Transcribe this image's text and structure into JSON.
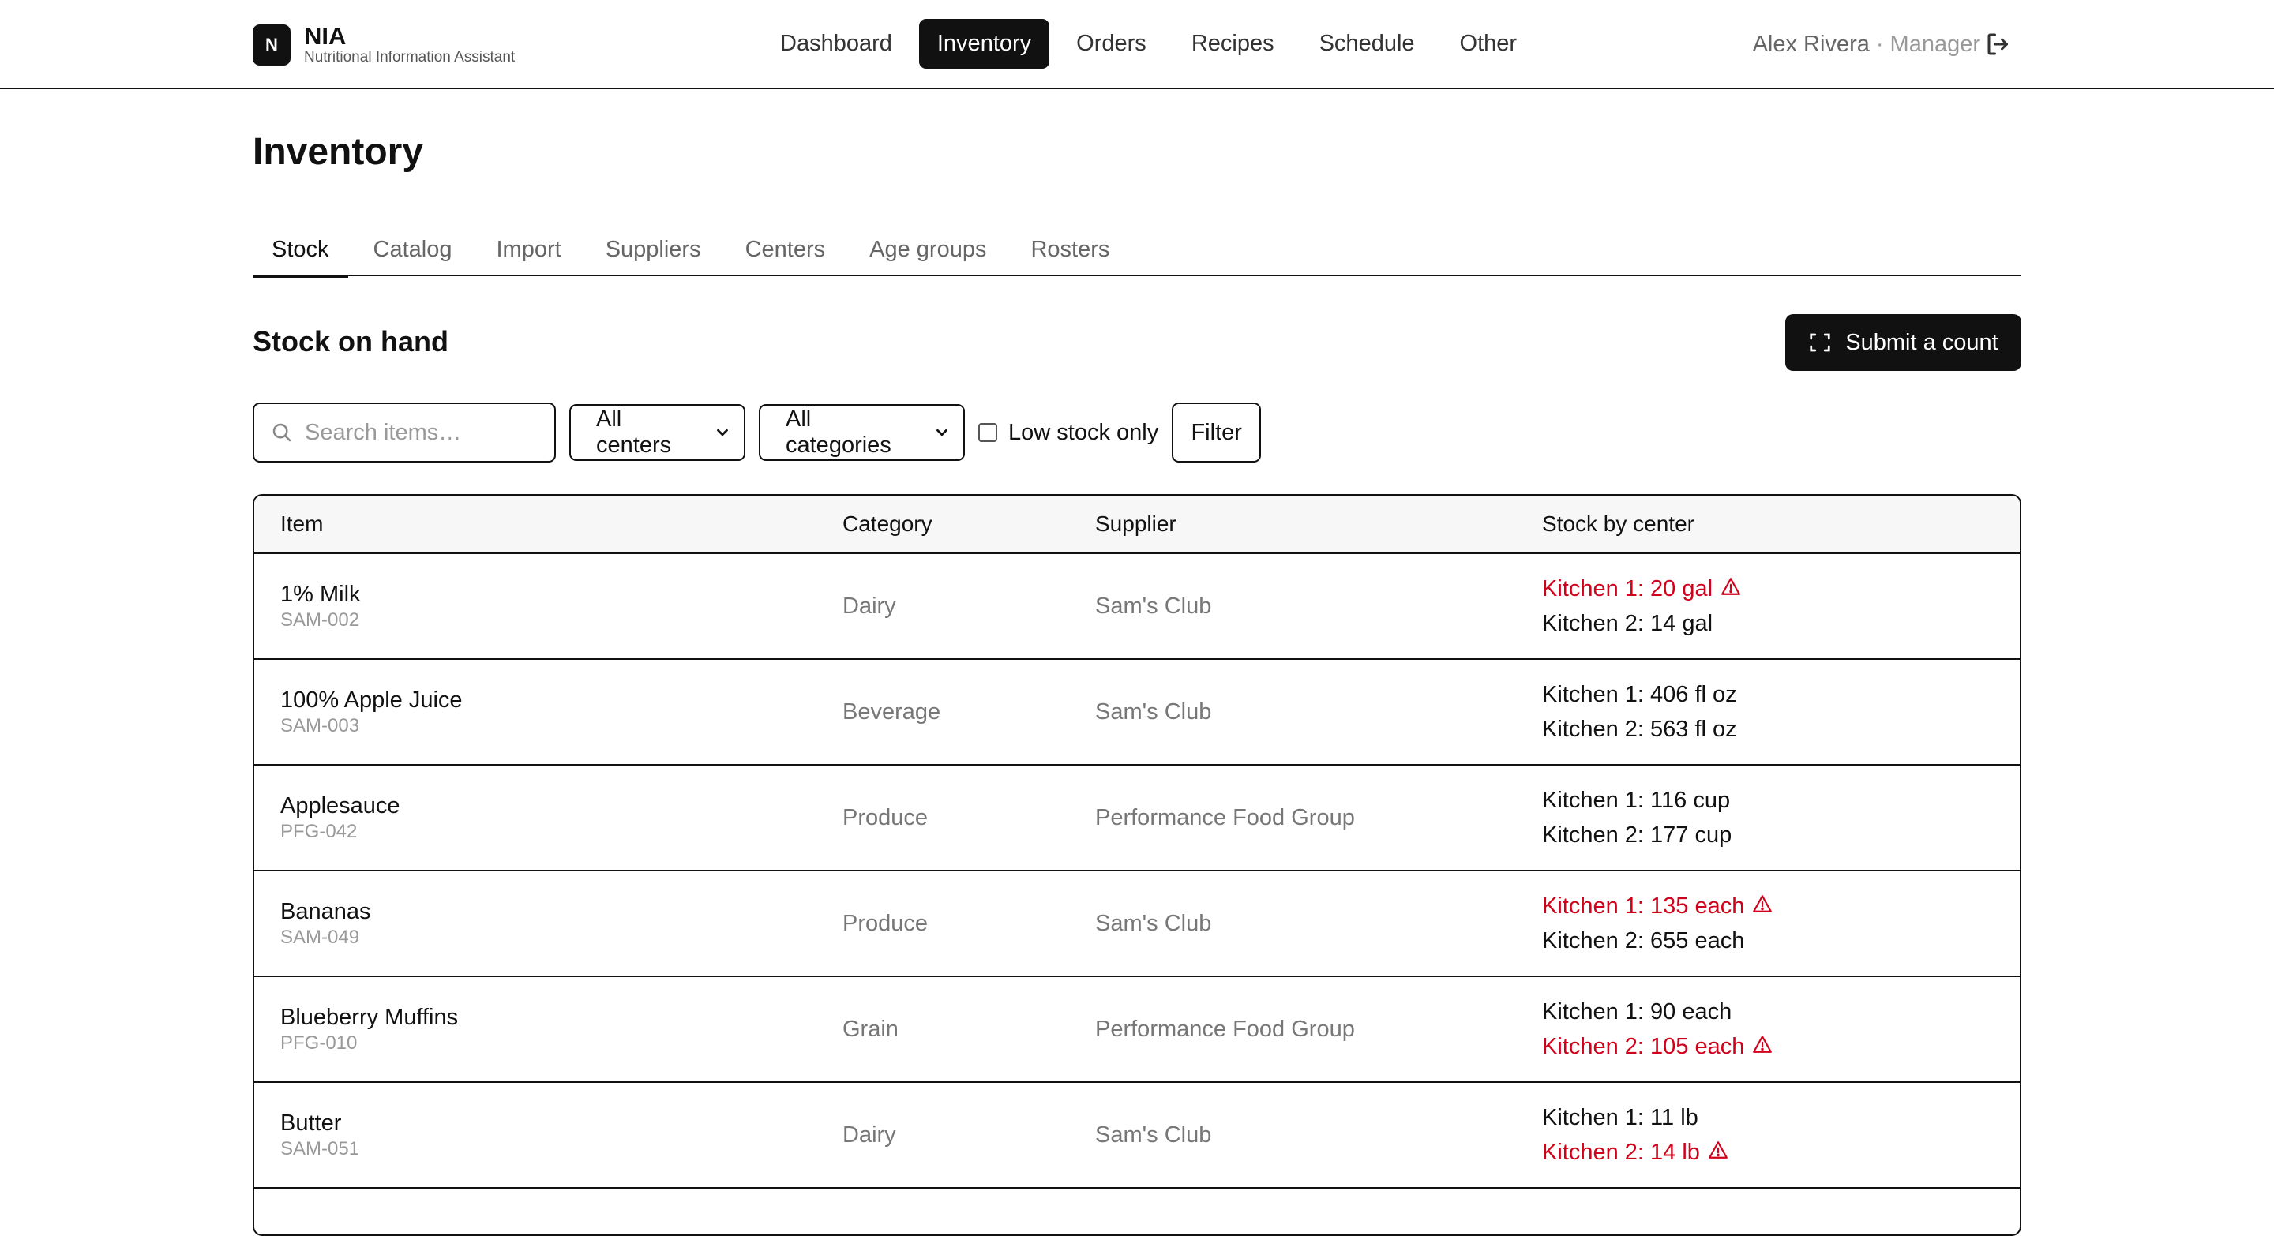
{
  "app": {
    "logo_letter": "N",
    "name": "NIA",
    "subtitle": "Nutritional Information Assistant"
  },
  "nav": {
    "items": [
      {
        "label": "Dashboard",
        "active": false
      },
      {
        "label": "Inventory",
        "active": true
      },
      {
        "label": "Orders",
        "active": false
      },
      {
        "label": "Recipes",
        "active": false
      },
      {
        "label": "Schedule",
        "active": false
      },
      {
        "label": "Other",
        "active": false
      }
    ]
  },
  "user": {
    "name": "Alex Rivera",
    "separator": "·",
    "role": "Manager",
    "logout_icon": "logout-icon"
  },
  "page": {
    "title": "Inventory",
    "tabs": [
      {
        "label": "Stock",
        "active": true
      },
      {
        "label": "Catalog",
        "active": false
      },
      {
        "label": "Import",
        "active": false
      },
      {
        "label": "Suppliers",
        "active": false
      },
      {
        "label": "Centers",
        "active": false
      },
      {
        "label": "Age groups",
        "active": false
      },
      {
        "label": "Rosters",
        "active": false
      }
    ],
    "section_title": "Stock on hand",
    "submit_label": "Submit a count"
  },
  "filters": {
    "search_placeholder": "Search items…",
    "center_select": "All centers",
    "category_select": "All categories",
    "low_stock_label": "Low stock only",
    "low_stock_checked": false,
    "filter_label": "Filter"
  },
  "table": {
    "headers": {
      "item": "Item",
      "category": "Category",
      "supplier": "Supplier",
      "stock": "Stock by center"
    },
    "rows": [
      {
        "name": "1% Milk",
        "sku": "SAM-002",
        "category": "Dairy",
        "supplier": "Sam's Club",
        "stock": [
          {
            "text": "Kitchen 1: 20 gal",
            "low": true
          },
          {
            "text": "Kitchen 2: 14 gal",
            "low": false
          }
        ]
      },
      {
        "name": "100% Apple Juice",
        "sku": "SAM-003",
        "category": "Beverage",
        "supplier": "Sam's Club",
        "stock": [
          {
            "text": "Kitchen 1: 406 fl oz",
            "low": false
          },
          {
            "text": "Kitchen 2: 563 fl oz",
            "low": false
          }
        ]
      },
      {
        "name": "Applesauce",
        "sku": "PFG-042",
        "category": "Produce",
        "supplier": "Performance Food Group",
        "stock": [
          {
            "text": "Kitchen 1: 116 cup",
            "low": false
          },
          {
            "text": "Kitchen 2: 177 cup",
            "low": false
          }
        ]
      },
      {
        "name": "Bananas",
        "sku": "SAM-049",
        "category": "Produce",
        "supplier": "Sam's Club",
        "stock": [
          {
            "text": "Kitchen 1: 135 each",
            "low": true
          },
          {
            "text": "Kitchen 2: 655 each",
            "low": false
          }
        ]
      },
      {
        "name": "Blueberry Muffins",
        "sku": "PFG-010",
        "category": "Grain",
        "supplier": "Performance Food Group",
        "stock": [
          {
            "text": "Kitchen 1: 90 each",
            "low": false
          },
          {
            "text": "Kitchen 2: 105 each",
            "low": true
          }
        ]
      },
      {
        "name": "Butter",
        "sku": "SAM-051",
        "category": "Dairy",
        "supplier": "Sam's Club",
        "stock": [
          {
            "text": "Kitchen 1: 11 lb",
            "low": false
          },
          {
            "text": "Kitchen 2: 14 lb",
            "low": true
          }
        ]
      }
    ]
  },
  "colors": {
    "primary": "#111111",
    "low_stock": "#d0021b",
    "muted_text": "#777777",
    "border": "#111111"
  }
}
